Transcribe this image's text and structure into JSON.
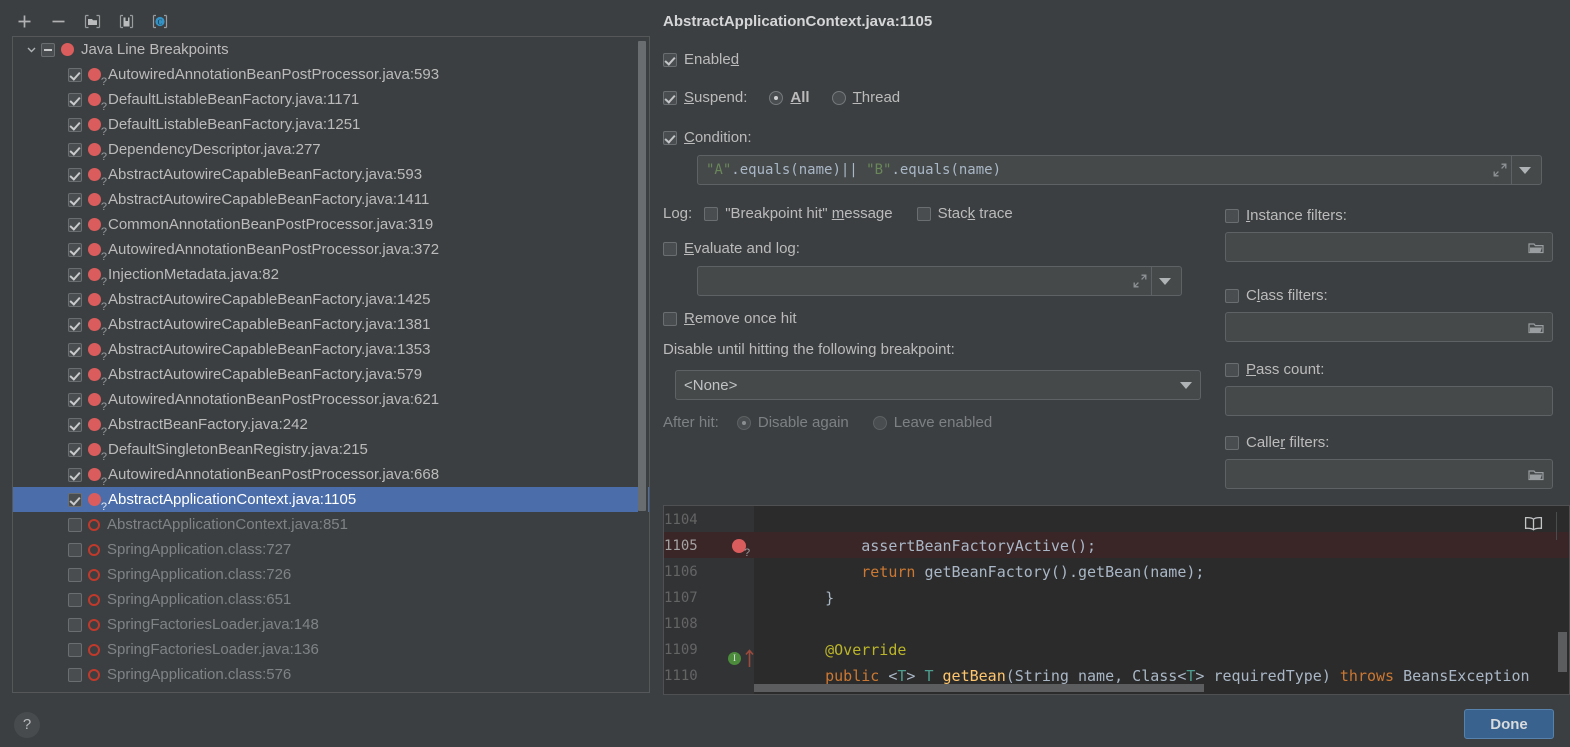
{
  "toolbar": {
    "add_label": "+",
    "remove_label": "−",
    "items": [
      {
        "name": "add-breakpoint-button",
        "icon": "plus-icon"
      },
      {
        "name": "remove-breakpoint-button",
        "icon": "minus-icon"
      },
      {
        "name": "group-by-file-button",
        "icon": "folder-icon"
      },
      {
        "name": "group-by-package-button",
        "icon": "package-icon"
      },
      {
        "name": "group-by-class-button",
        "icon": "class-icon"
      }
    ]
  },
  "tree": {
    "group_label": "Java Line Breakpoints",
    "items": [
      {
        "label": "AutowiredAnnotationBeanPostProcessor.java:593",
        "checked": true
      },
      {
        "label": "DefaultListableBeanFactory.java:1171",
        "checked": true
      },
      {
        "label": "DefaultListableBeanFactory.java:1251",
        "checked": true
      },
      {
        "label": "DependencyDescriptor.java:277",
        "checked": true
      },
      {
        "label": "AbstractAutowireCapableBeanFactory.java:593",
        "checked": true
      },
      {
        "label": "AbstractAutowireCapableBeanFactory.java:1411",
        "checked": true
      },
      {
        "label": "CommonAnnotationBeanPostProcessor.java:319",
        "checked": true
      },
      {
        "label": "AutowiredAnnotationBeanPostProcessor.java:372",
        "checked": true
      },
      {
        "label": "InjectionMetadata.java:82",
        "checked": true
      },
      {
        "label": "AbstractAutowireCapableBeanFactory.java:1425",
        "checked": true
      },
      {
        "label": "AbstractAutowireCapableBeanFactory.java:1381",
        "checked": true
      },
      {
        "label": "AbstractAutowireCapableBeanFactory.java:1353",
        "checked": true
      },
      {
        "label": "AbstractAutowireCapableBeanFactory.java:579",
        "checked": true
      },
      {
        "label": "AutowiredAnnotationBeanPostProcessor.java:621",
        "checked": true
      },
      {
        "label": "AbstractBeanFactory.java:242",
        "checked": true
      },
      {
        "label": "DefaultSingletonBeanRegistry.java:215",
        "checked": true
      },
      {
        "label": "AutowiredAnnotationBeanPostProcessor.java:668",
        "checked": true
      },
      {
        "label": "AbstractApplicationContext.java:1105",
        "checked": true,
        "selected": true
      },
      {
        "label": "AbstractApplicationContext.java:851",
        "checked": false
      },
      {
        "label": "SpringApplication.class:727",
        "checked": false
      },
      {
        "label": "SpringApplication.class:726",
        "checked": false
      },
      {
        "label": "SpringApplication.class:651",
        "checked": false
      },
      {
        "label": "SpringFactoriesLoader.java:148",
        "checked": false
      },
      {
        "label": "SpringFactoriesLoader.java:136",
        "checked": false
      },
      {
        "label": "SpringApplication.class:576",
        "checked": false
      }
    ]
  },
  "details": {
    "title": "AbstractApplicationContext.java:1105",
    "enabled": {
      "label_pre": "Enable",
      "label_mn": "d",
      "label_post": "",
      "checked": true
    },
    "suspend": {
      "label_pre": "",
      "label_mn": "S",
      "label_post": "uspend:",
      "checked": true,
      "all": {
        "pre": "",
        "mn": "A",
        "post": "ll",
        "selected": true
      },
      "thread": {
        "pre": "",
        "mn": "T",
        "post": "hread",
        "selected": false
      }
    },
    "condition": {
      "label_pre": "",
      "label_mn": "C",
      "label_post": "ondition:",
      "checked": true,
      "value_parts": [
        {
          "text": "\"A\"",
          "kind": "string"
        },
        {
          "text": ".equals(name)|| ",
          "kind": "plain"
        },
        {
          "text": "\"B\"",
          "kind": "string"
        },
        {
          "text": ".equals(name)",
          "kind": "plain"
        }
      ],
      "value": "\"A\".equals(name)|| \"B\".equals(name)"
    },
    "log": {
      "label": "Log:",
      "breakpoint_hit": {
        "pre": "\"Breakpoint hit\" ",
        "mn": "m",
        "post": "essage",
        "checked": false
      },
      "stack_trace": {
        "pre": "Stac",
        "mn": "k",
        "post": " trace",
        "checked": false
      }
    },
    "evaluate_and_log": {
      "pre": "",
      "mn": "E",
      "post": "valuate and log:",
      "checked": false,
      "value": ""
    },
    "remove_once_hit": {
      "pre": "",
      "mn": "R",
      "post": "emove once hit",
      "checked": false
    },
    "disable_until": {
      "label": "Disable until hitting the following breakpoint:",
      "selected": "<None>",
      "options": [
        "<None>"
      ]
    },
    "after_hit": {
      "label": "After hit:",
      "disable_again": {
        "label": "Disable again",
        "selected": true
      },
      "leave_enabled": {
        "label": "Leave enabled",
        "selected": false
      }
    },
    "filters": [
      {
        "key": "instance",
        "pre": "",
        "mn": "I",
        "post": "nstance filters:",
        "checked": false,
        "value": "",
        "has_browse": true
      },
      {
        "key": "class",
        "pre": "C",
        "mn": "l",
        "post": "ass filters:",
        "checked": false,
        "value": "",
        "has_browse": true
      },
      {
        "key": "pass",
        "pre": "",
        "mn": "P",
        "post": "ass count:",
        "checked": false,
        "value": "",
        "has_browse": false
      },
      {
        "key": "caller",
        "pre": "Calle",
        "mn": "r",
        "post": " filters:",
        "checked": false,
        "value": "",
        "has_browse": true
      }
    ]
  },
  "code": {
    "lines": [
      {
        "num": "1104",
        "indent": 0,
        "highlight": false,
        "tokens": [
          {
            "t": "        assertBeanFactoryActive();",
            "c": "pun"
          }
        ]
      },
      {
        "num": "1105",
        "indent": 0,
        "highlight": true,
        "breakpoint": true,
        "tokens": [
          {
            "t": "        ",
            "c": "pun"
          },
          {
            "t": "return",
            "c": "kw"
          },
          {
            "t": " getBeanFactory().getBean(name);",
            "c": "pun"
          }
        ]
      },
      {
        "num": "1106",
        "indent": 0,
        "highlight": false,
        "tokens": [
          {
            "t": "    }",
            "c": "pun"
          }
        ]
      },
      {
        "num": "1107",
        "indent": 0,
        "highlight": false,
        "tokens": [
          {
            "t": "",
            "c": "pun"
          }
        ]
      },
      {
        "num": "1108",
        "indent": 0,
        "highlight": false,
        "tokens": [
          {
            "t": "    ",
            "c": "pun"
          },
          {
            "t": "@Override",
            "c": "ann"
          }
        ]
      },
      {
        "num": "1109",
        "indent": 0,
        "highlight": false,
        "impl_marker": true,
        "tokens": [
          {
            "t": "    ",
            "c": "pun"
          },
          {
            "t": "public",
            "c": "kw"
          },
          {
            "t": " <",
            "c": "pun"
          },
          {
            "t": "T",
            "c": "typ"
          },
          {
            "t": "> ",
            "c": "pun"
          },
          {
            "t": "T",
            "c": "typ"
          },
          {
            "t": " ",
            "c": "pun"
          },
          {
            "t": "getBean",
            "c": "fn"
          },
          {
            "t": "(String name, Class<",
            "c": "pun"
          },
          {
            "t": "T",
            "c": "typ"
          },
          {
            "t": "> requiredType) ",
            "c": "pun"
          },
          {
            "t": "throws",
            "c": "kw"
          },
          {
            "t": " BeansException",
            "c": "pun"
          }
        ]
      },
      {
        "num": "1110",
        "indent": 0,
        "highlight": false,
        "tokens": [
          {
            "t": "        assertBeanFactoryActive();",
            "c": "pun"
          }
        ]
      }
    ],
    "book_icon": "documentation-icon"
  },
  "footer": {
    "help_label": "?",
    "done_label": "Done"
  },
  "colors": {
    "background": "#3c3f41",
    "selection": "#4b6eab",
    "accent_button": "#3a628f",
    "breakpoint_red": "#db5c5c",
    "code_background": "#2b2b2b",
    "code_highlight": "#3a2527",
    "string_green": "#6a8759",
    "keyword_orange": "#cc7832",
    "annotation_yellow": "#bbb529",
    "type_teal": "#4e9e8f",
    "method_gold": "#ffc66d"
  }
}
